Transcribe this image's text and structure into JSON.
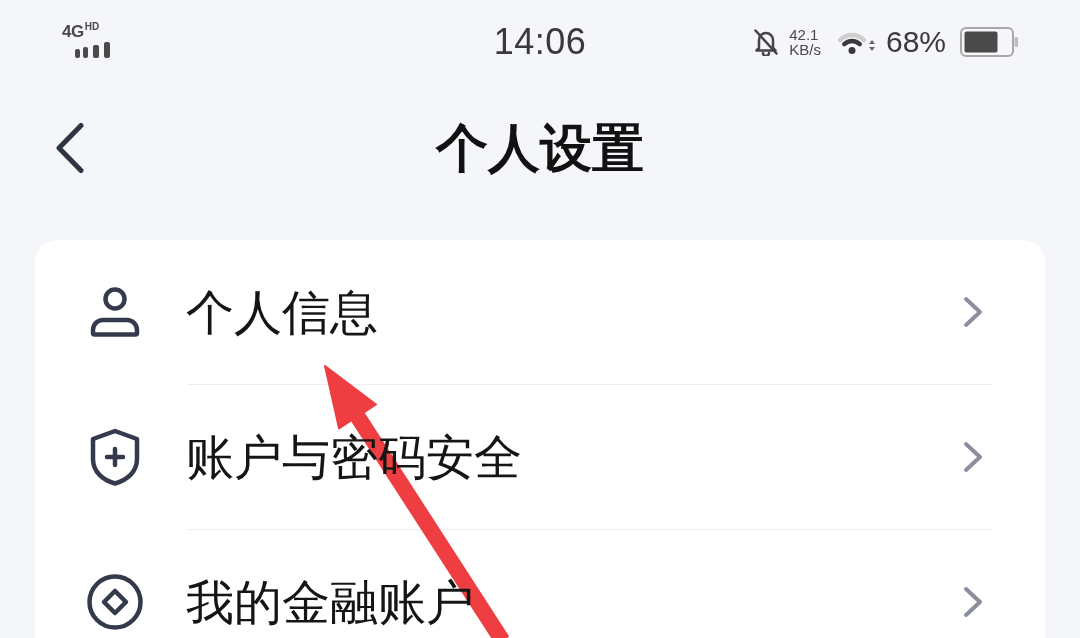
{
  "status_bar": {
    "network": "4G",
    "network_badge": "HD",
    "time": "14:06",
    "speed_value": "42.1",
    "speed_unit": "KB/s",
    "battery_percent": "68%"
  },
  "header": {
    "title": "个人设置"
  },
  "settings": [
    {
      "label": "个人信息"
    },
    {
      "label": "账户与密码安全"
    },
    {
      "label": "我的金融账户"
    }
  ]
}
